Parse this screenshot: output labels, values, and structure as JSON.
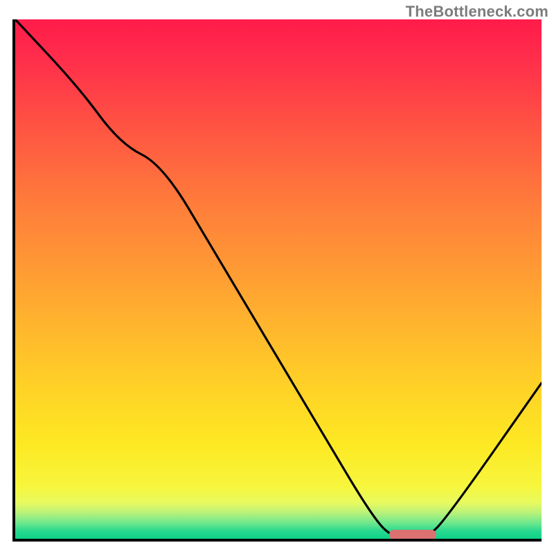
{
  "watermark": "TheBottleneck.com",
  "colors": {
    "axis": "#000000",
    "curve": "#000000",
    "marker": "#db7171",
    "watermark_text": "#7c7c7c",
    "gradient_top": "#ff1b4a",
    "gradient_bottom": "#0fd28a"
  },
  "chart_data": {
    "type": "line",
    "title": "",
    "xlabel": "",
    "ylabel": "",
    "xlim": [
      0,
      100
    ],
    "ylim": [
      0,
      100
    ],
    "grid": false,
    "legend": false,
    "x": [
      0,
      12,
      20,
      28,
      38,
      48,
      58,
      68,
      72,
      78,
      82,
      100
    ],
    "values": [
      100,
      87,
      76,
      72,
      55,
      38,
      21,
      4,
      0,
      0,
      4,
      30
    ],
    "marker": {
      "x_start": 71,
      "x_end": 80,
      "y": 0
    },
    "notes": "Values estimated from pixel positions; curve descends from top-left, dips to floor near x≈72–80 (pink marker), then rises to ~30 at right edge."
  }
}
